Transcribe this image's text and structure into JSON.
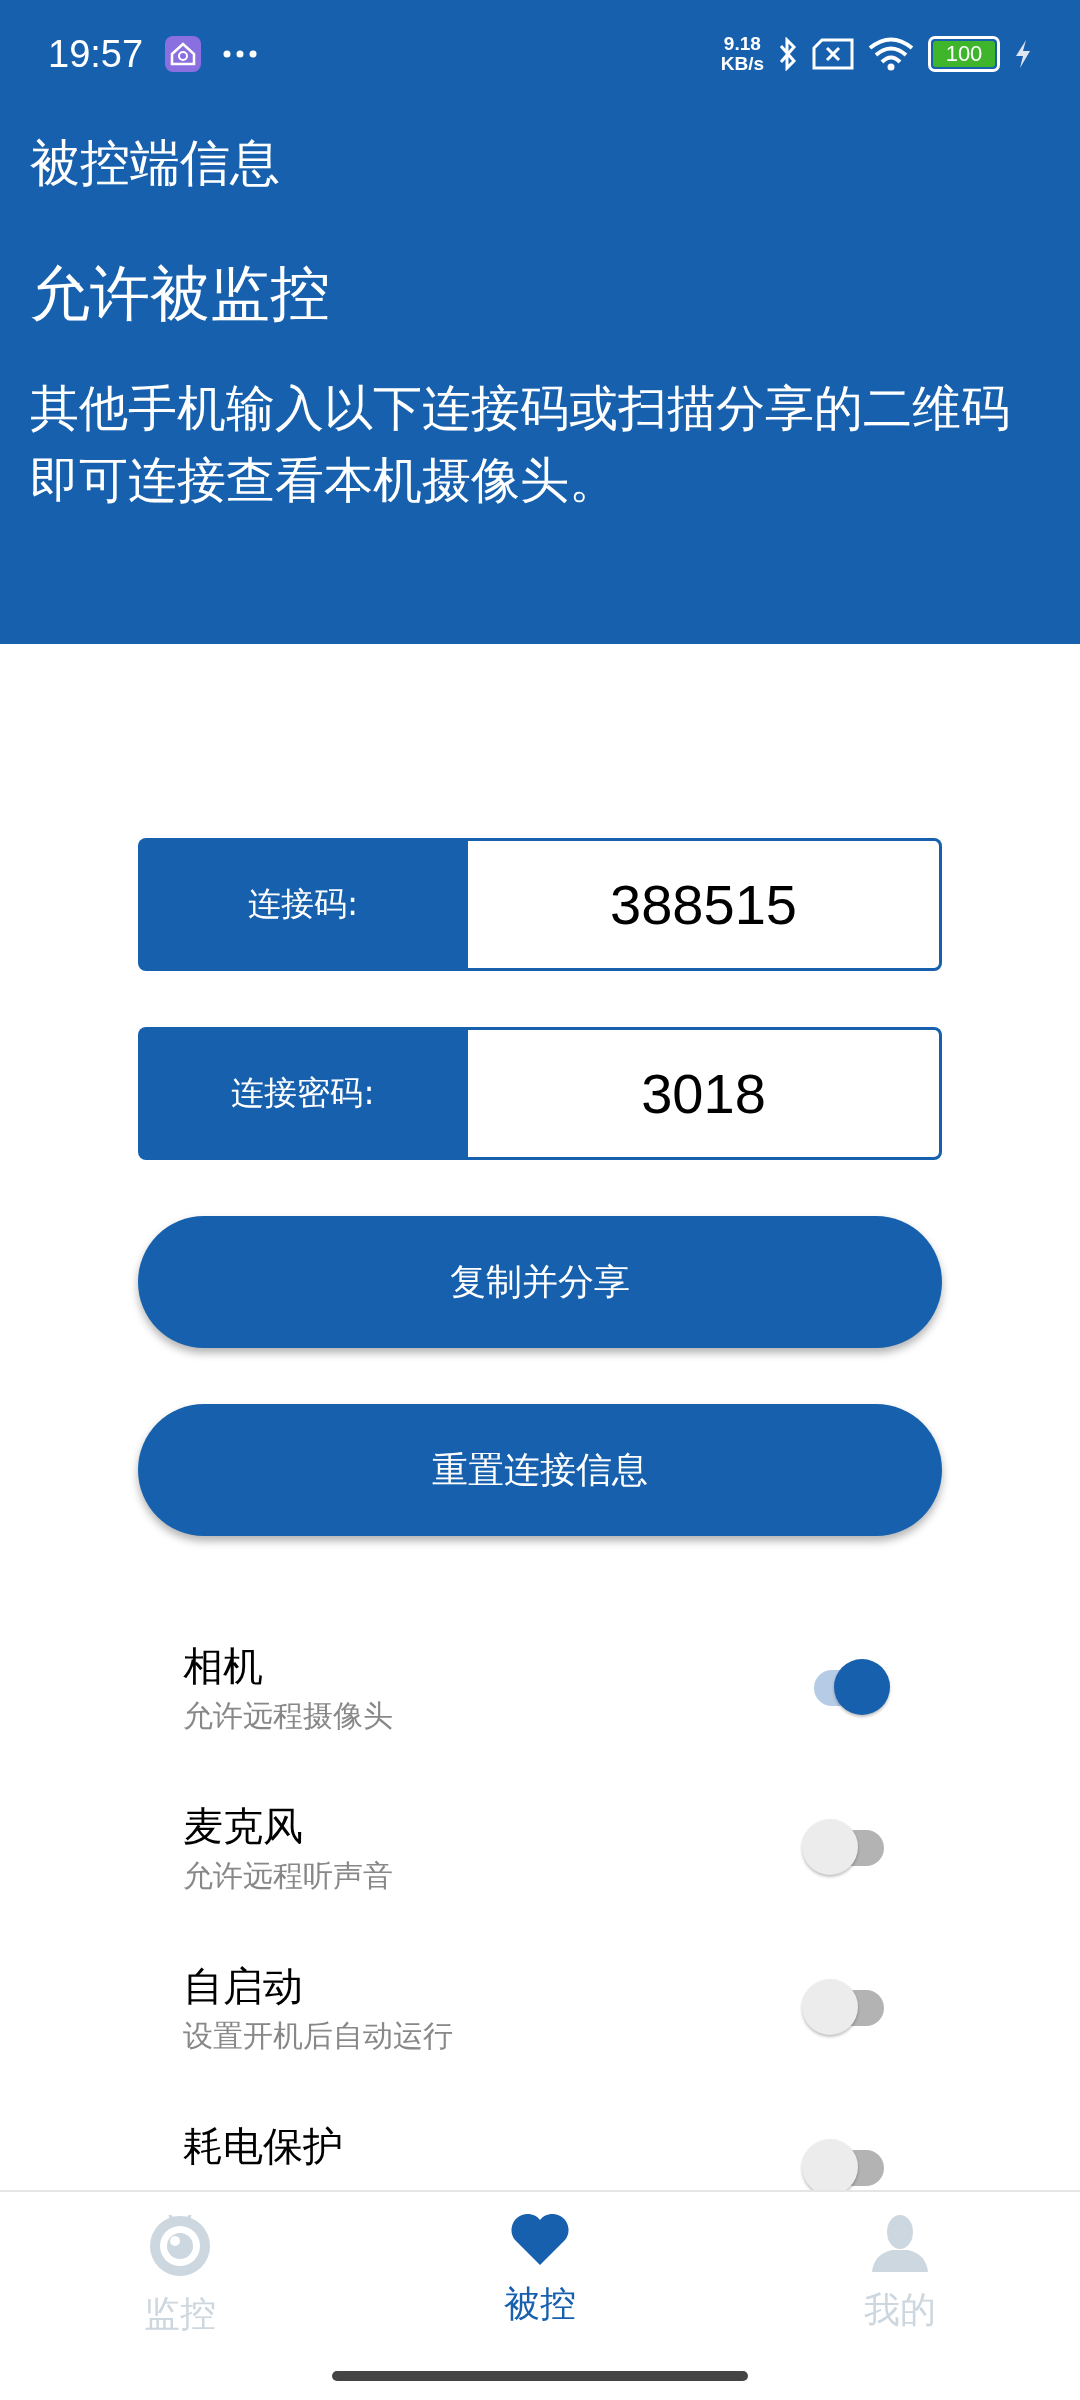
{
  "status_bar": {
    "time": "19:57",
    "net_speed": "9.18",
    "net_unit": "KB/s",
    "battery": "100"
  },
  "header": {
    "title": "被控端信息",
    "heading": "允许被监控",
    "description": "其他手机输入以下连接码或扫描分享的二维码即可连接查看本机摄像头。"
  },
  "fields": [
    {
      "label": "连接码:",
      "value": "388515"
    },
    {
      "label": "连接密码:",
      "value": "3018"
    }
  ],
  "buttons": [
    "复制并分享",
    "重置连接信息"
  ],
  "settings": [
    {
      "title": "相机",
      "subtitle": "允许远程摄像头",
      "on": true
    },
    {
      "title": "麦克风",
      "subtitle": "允许远程听声音",
      "on": false
    },
    {
      "title": "自启动",
      "subtitle": "设置开机后自动运行",
      "on": false
    },
    {
      "title": "耗电保护",
      "on": false
    }
  ],
  "nav": [
    {
      "label": "监控",
      "kind": "eye",
      "selected": false
    },
    {
      "label": "被控",
      "kind": "heart",
      "selected": true
    },
    {
      "label": "我的",
      "kind": "person",
      "selected": false
    }
  ]
}
